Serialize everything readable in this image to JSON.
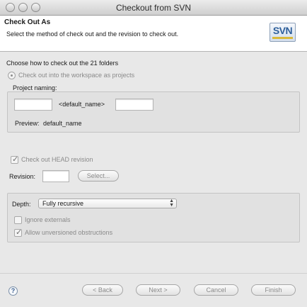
{
  "window": {
    "title": "Checkout from SVN"
  },
  "header": {
    "title": "Check Out As",
    "description": "Select the method of check out and the revision to check out.",
    "logo_text": "SVN"
  },
  "main": {
    "choose_label": "Choose how to check out the 21 folders",
    "radio_workspace_label": "Check out into the workspace as projects",
    "project_naming_label": "Project naming:",
    "prefix_value": "",
    "default_name_label": "<default_name>",
    "suffix_value": "",
    "preview_label": "Preview:",
    "preview_value": "default_name",
    "head_revision_label": "Check out HEAD revision",
    "head_revision_checked": true,
    "revision_label": "Revision:",
    "revision_value": "",
    "select_button": "Select...",
    "depth_label": "Depth:",
    "depth_value": "Fully recursive",
    "ignore_externals_label": "Ignore externals",
    "ignore_externals_checked": false,
    "allow_unversioned_label": "Allow unversioned obstructions",
    "allow_unversioned_checked": true
  },
  "footer": {
    "help_icon": "?",
    "back_button": "< Back",
    "next_button": "Next >",
    "cancel_button": "Cancel",
    "finish_button": "Finish"
  }
}
